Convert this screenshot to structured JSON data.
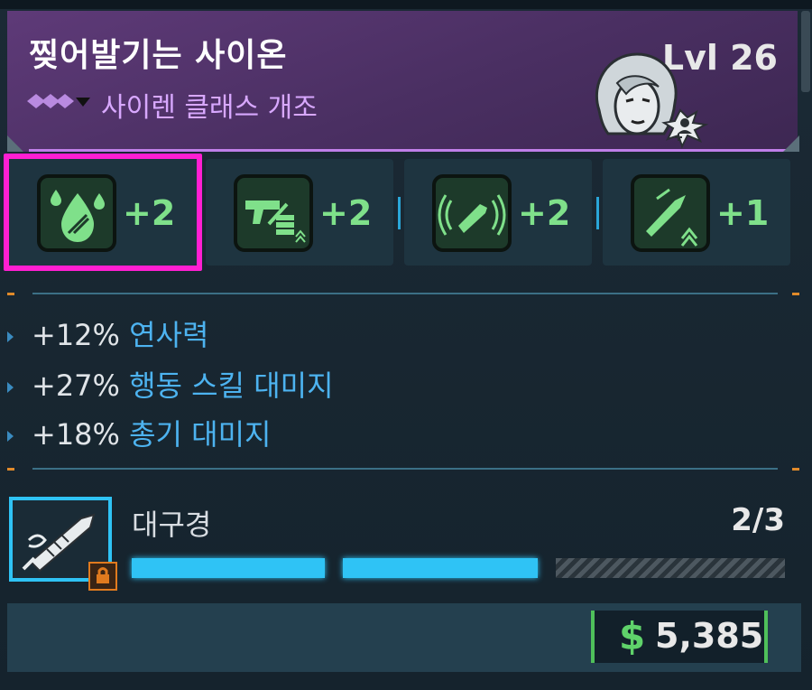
{
  "header": {
    "title": "찢어발기는 사이온",
    "subtitle": "사이렌 클래스 개조",
    "level": "Lvl 26",
    "rarity_icon": "rarity-chevrons-icon",
    "class_icon": "siren-class-icon",
    "accent": "#c07ee8"
  },
  "perks": [
    {
      "icon": "blood-drop-icon",
      "value": "+2",
      "selected": true
    },
    {
      "icon": "pistol-ammo-icon",
      "value": "+2",
      "selected": false
    },
    {
      "icon": "signal-bullet-icon",
      "value": "+2",
      "selected": false
    },
    {
      "icon": "bullet-upgrade-icon",
      "value": "+1",
      "selected": false
    }
  ],
  "stats": [
    {
      "pct": "+12%",
      "name": "연사력"
    },
    {
      "pct": "+27%",
      "name": "행동 스킬 대미지"
    },
    {
      "pct": "+18%",
      "name": "총기 대미지"
    }
  ],
  "relic": {
    "name": "대구경",
    "progress": "2/3",
    "filled": 2,
    "total": 3,
    "icon": "syringe-icon",
    "lock_icon": "lock-icon"
  },
  "price": {
    "currency_symbol": "$",
    "amount": "5,385"
  },
  "colors": {
    "selection": "#ff1fd2",
    "perk_value": "#7fe08a",
    "stat_name": "#4db3f0",
    "progress_on": "#2fc3f5"
  }
}
